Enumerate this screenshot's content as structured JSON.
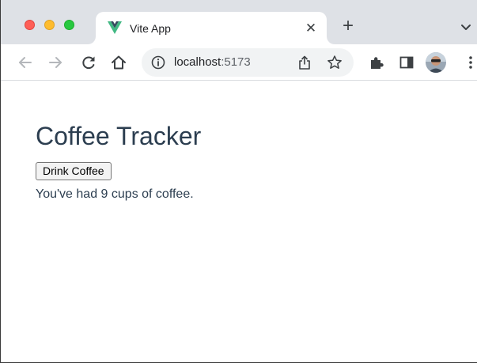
{
  "browser": {
    "tab": {
      "title": "Vite App",
      "favicon": "vue-logo-icon",
      "close_glyph": "✕"
    },
    "new_tab_glyph": "+",
    "address_bar": {
      "host": "localhost",
      "port": ":5173"
    },
    "icons": [
      "back-arrow-icon",
      "forward-arrow-icon",
      "reload-icon",
      "home-icon",
      "site-info-icon",
      "share-icon",
      "bookmark-star-icon",
      "extensions-puzzle-icon",
      "side-panel-icon",
      "profile-avatar",
      "more-menu-icon",
      "tab-search-chevron-icon"
    ],
    "colors": {
      "tabstrip": "#dee1e6",
      "omnibox": "#f1f3f4",
      "traffic_close": "#fe5f57",
      "traffic_minimize": "#febc2e",
      "traffic_maximize": "#28c840",
      "vue_green": "#41b883",
      "vue_dark": "#35495e"
    }
  },
  "page": {
    "title": "Coffee Tracker",
    "button_label": "Drink Coffee",
    "cups_prefix": "You've had ",
    "cups_count": 9,
    "cups_suffix": " cups of coffee.",
    "text_color": "#2c3e50"
  }
}
